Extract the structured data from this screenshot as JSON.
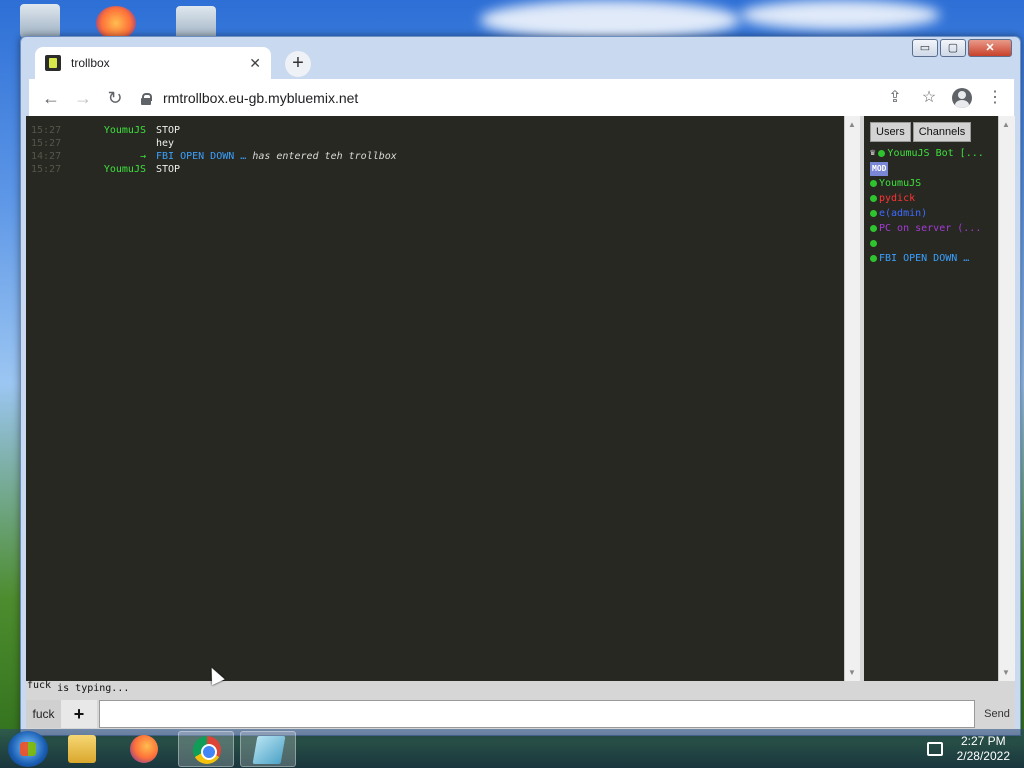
{
  "browser": {
    "tab_title": "trollbox",
    "url": "rmtrollbox.eu-gb.mybluemix.net",
    "window_controls": {
      "minimize": "▭",
      "maximize": "▢",
      "close": "✕"
    }
  },
  "chat": {
    "messages": [
      {
        "time": "15:27",
        "nick": "YoumuJS",
        "nick_color": "#3de03d",
        "text": "STOP"
      },
      {
        "time": "15:27",
        "nick": "",
        "nick_color": "#3aa0ff",
        "text": "hey"
      },
      {
        "time": "14:27",
        "nick": "→",
        "nick_color": "#3de03d",
        "join_nick": "FBI OPEN DOWN …",
        "text": "has entered teh trollbox"
      },
      {
        "time": "15:27",
        "nick": "YoumuJS",
        "nick_color": "#3de03d",
        "text": "STOP"
      }
    ],
    "typing_user": "fuck",
    "typing_text": "is typing...",
    "channel_button": "fuck",
    "add_button": "+",
    "send_button": "Send",
    "input_value": ""
  },
  "sidebar": {
    "tabs": [
      "Users",
      "Channels"
    ],
    "users": [
      {
        "name": "YoumuJS Bot [...",
        "color": "#3de03d",
        "crown": true
      },
      {
        "name": "",
        "badge": "MOD"
      },
      {
        "name": "YoumuJS",
        "color": "#3de03d"
      },
      {
        "name": "pydick",
        "color": "#ff3333"
      },
      {
        "name": "e(admin)",
        "color": "#3c6bff"
      },
      {
        "name": "PC on server (...",
        "color": "#a23bd6"
      },
      {
        "name": "",
        "color": "#3de03d"
      },
      {
        "name": "FBI OPEN DOWN …",
        "color": "#3aa0ff"
      }
    ]
  },
  "taskbar": {
    "time": "2:27 PM",
    "date": "2/28/2022",
    "apps": [
      "explorer-icon",
      "firefox-icon",
      "chrome-icon",
      "notepad-icon"
    ]
  }
}
